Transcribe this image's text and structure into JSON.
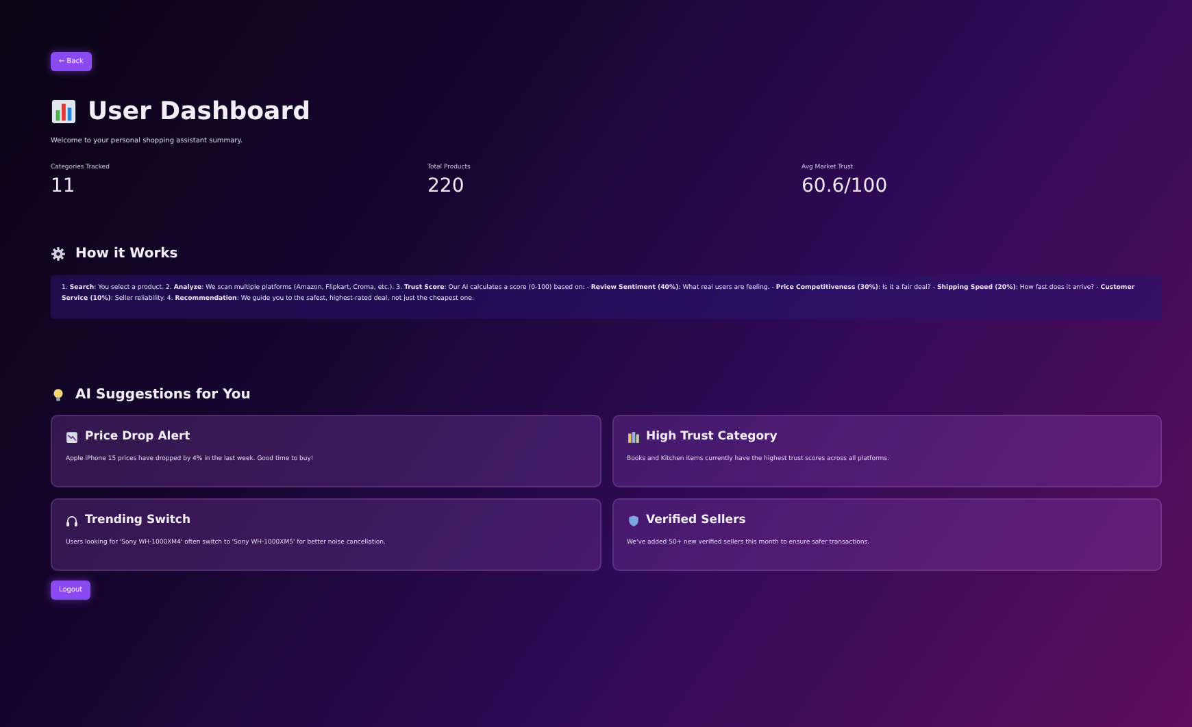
{
  "back_button": "← Back",
  "title": "User Dashboard",
  "subtitle": "Welcome to your personal shopping assistant summary.",
  "metrics": [
    {
      "label": "Categories Tracked",
      "value": "11"
    },
    {
      "label": "Total Products",
      "value": "220"
    },
    {
      "label": "Avg Market Trust",
      "value": "60.6/100"
    }
  ],
  "how_it_works": {
    "heading": "How it Works",
    "text": "1. **Search**: You select a product. 2. **Analyze**: We scan multiple platforms (Amazon, Flipkart, Croma, etc.). 3. **Trust Score**: Our AI calculates a score (0-100) based on: - **Review Sentiment (40%)**: What real users are feeling. - **Price Competitiveness (30%)**: Is it a fair deal? - **Shipping Speed (20%)**: How fast does it arrive? - **Customer Service (10%)**: Seller reliability. 4. **Recommendation**: We guide you to the safest, highest-rated deal, not just the cheapest one."
  },
  "suggestions": {
    "heading": "AI Suggestions for You",
    "cards": [
      {
        "kind": "chart",
        "title": "Price Drop Alert",
        "text": "Apple iPhone 15 prices have dropped by 4% in the last week. Good time to buy!"
      },
      {
        "kind": "books",
        "title": "High Trust Category",
        "text": "Books and Kitchen items currently have the highest trust scores across all platforms."
      },
      {
        "kind": "headphones",
        "title": "Trending Switch",
        "text": "Users looking for 'Sony WH-1000XM4' often switch to 'Sony WH-1000XM5' for better noise cancellation."
      },
      {
        "kind": "shield",
        "title": "Verified Sellers",
        "text": "We've added 50+ new verified sellers this month to ensure safer transactions."
      }
    ]
  },
  "logout_button": "Logout"
}
